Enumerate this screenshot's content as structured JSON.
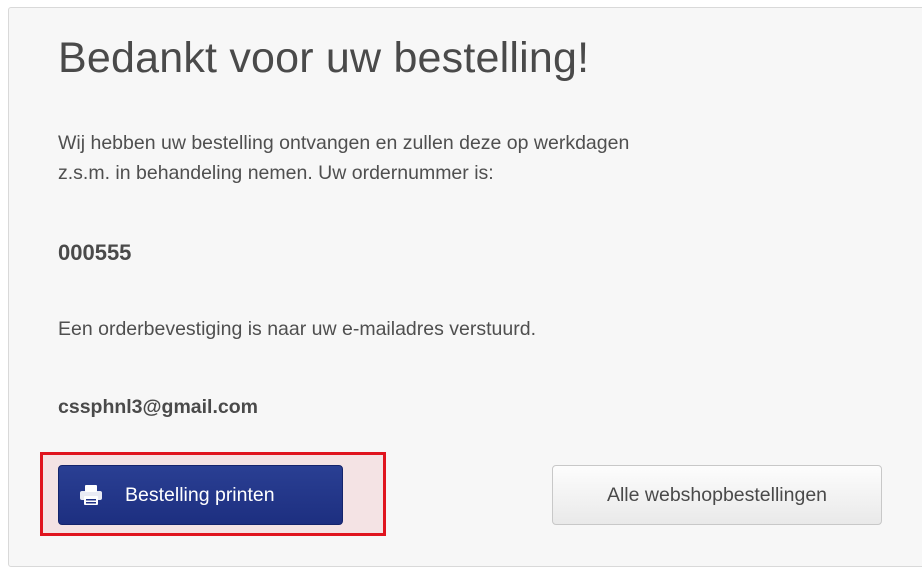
{
  "confirmation": {
    "title": "Bedankt voor uw bestelling!",
    "intro_line1": "Wij hebben uw bestelling ontvangen en zullen deze op werkdagen",
    "intro_line2": "z.s.m. in behandeling nemen. Uw ordernummer is:",
    "order_number": "000555",
    "email_notice": "Een orderbevestiging is naar uw e-mailadres verstuurd.",
    "email": "cssphnl3@gmail.com"
  },
  "actions": {
    "print_label": "Bestelling printen",
    "print_icon": "printer-icon",
    "all_orders_label": "Alle webshopbestellingen"
  },
  "colors": {
    "primary_button": "#1f3286",
    "highlight_border": "#e0141e",
    "panel_background": "#f7f7f7"
  }
}
